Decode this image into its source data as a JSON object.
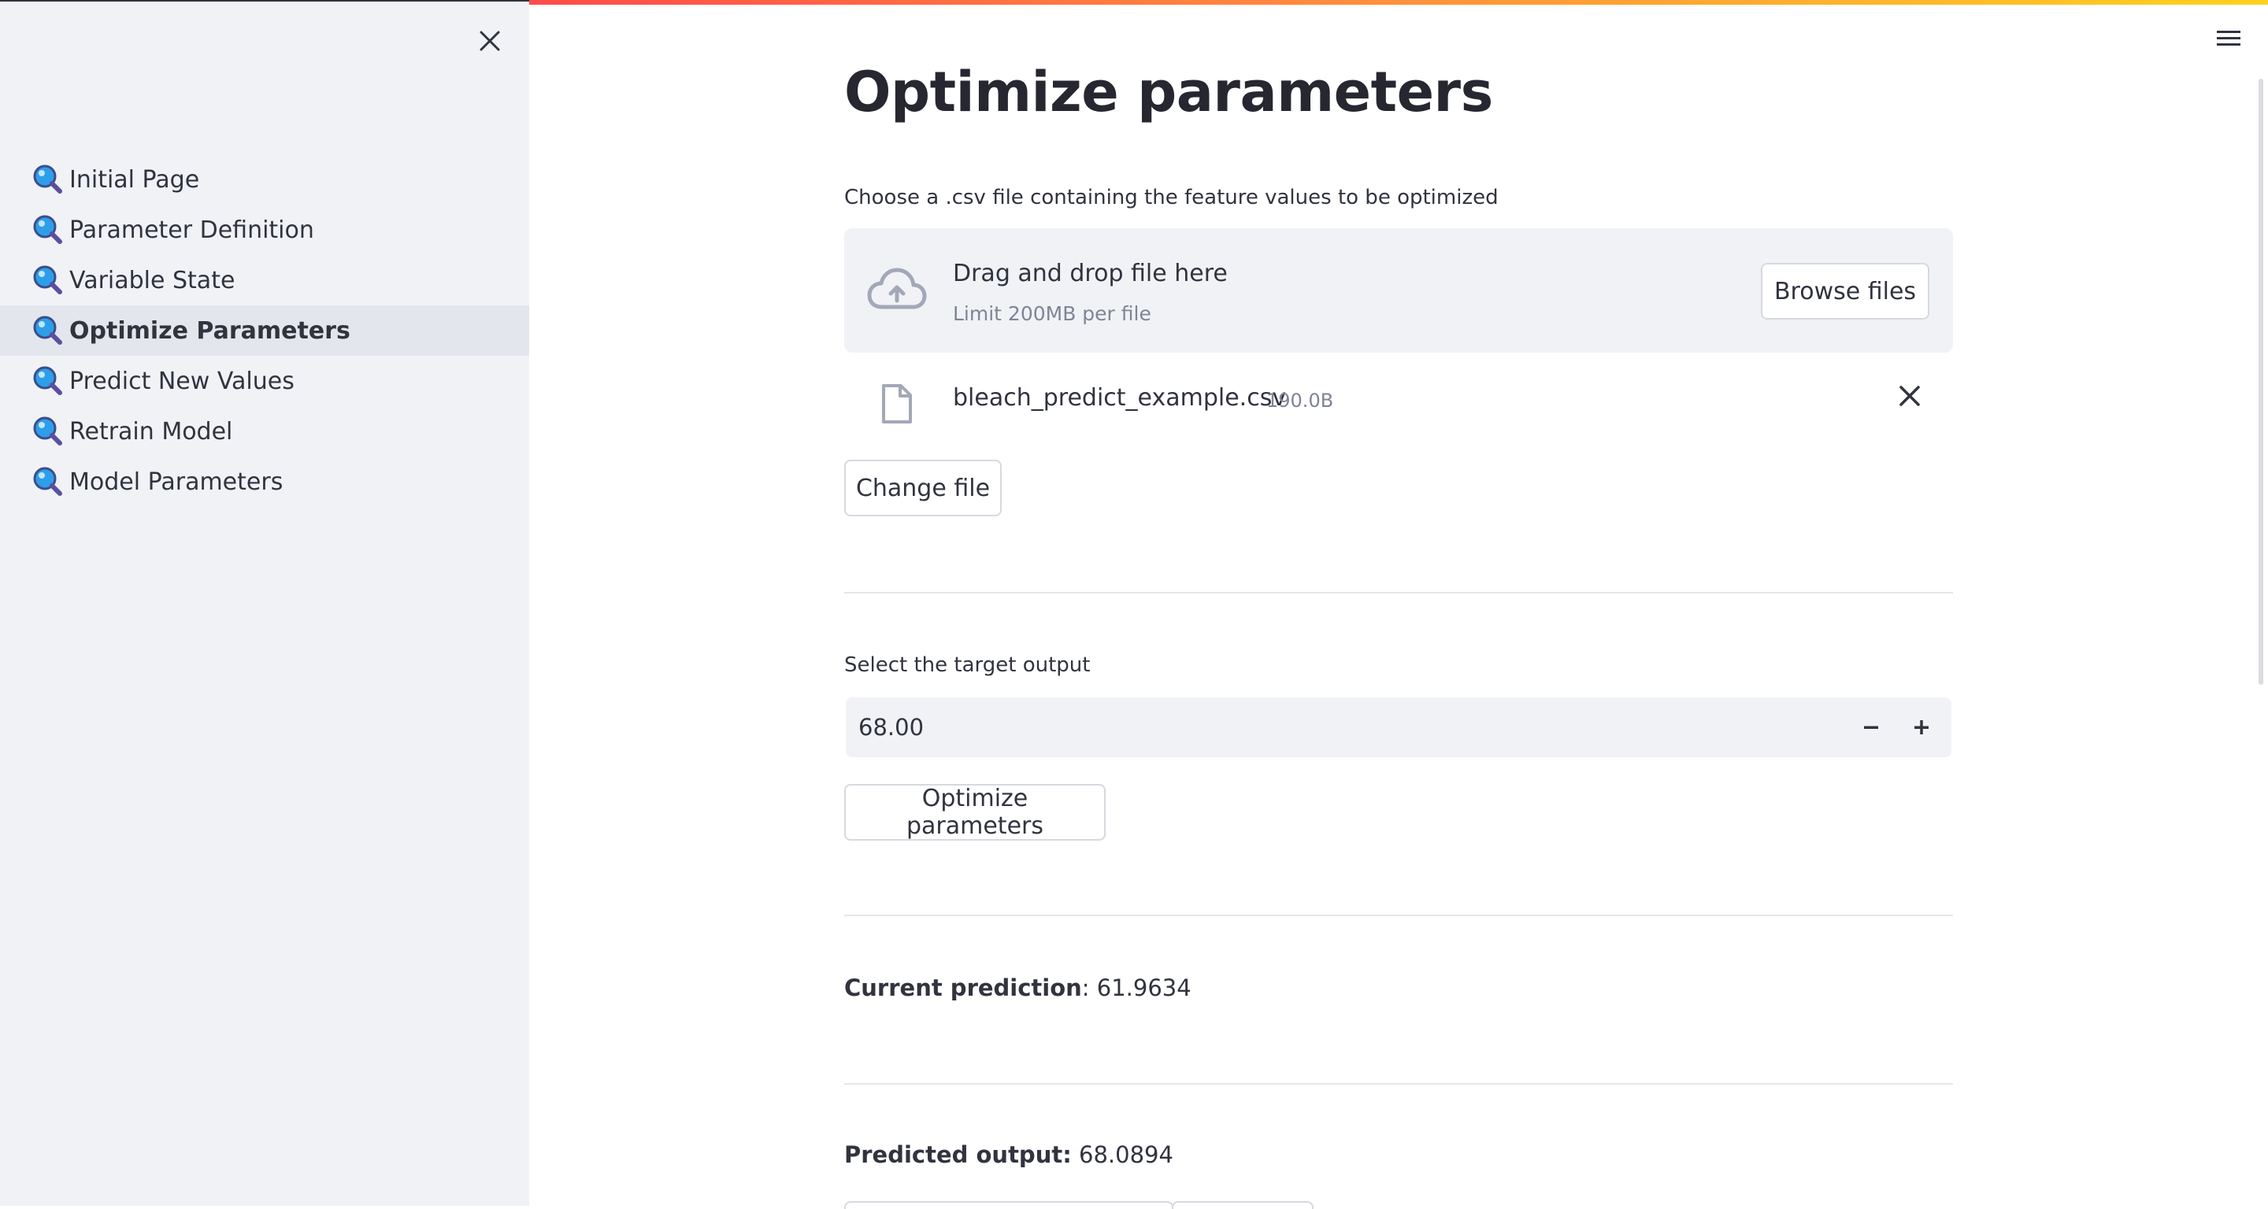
{
  "sidebar": {
    "items": [
      {
        "label": "Initial Page",
        "active": false
      },
      {
        "label": "Parameter Definition",
        "active": false
      },
      {
        "label": "Variable State",
        "active": false
      },
      {
        "label": "Optimize Parameters",
        "active": true
      },
      {
        "label": "Predict New Values",
        "active": false
      },
      {
        "label": "Retrain Model",
        "active": false
      },
      {
        "label": "Model Parameters",
        "active": false
      }
    ],
    "icon": "magnifier-icon"
  },
  "main": {
    "title": "Optimize parameters",
    "uploader": {
      "label": "Choose a .csv file containing the feature values to be optimized",
      "drop_title": "Drag and drop file here",
      "drop_limit": "Limit 200MB per file",
      "browse_label": "Browse files",
      "file_name": "bleach_predict_example.csv",
      "file_size": "190.0B",
      "change_label": "Change file"
    },
    "target": {
      "label": "Select the target output",
      "value": "68.00"
    },
    "optimize_label": "Optimize parameters",
    "current": {
      "label": "Current prediction",
      "value": ": 61.9634"
    },
    "predicted": {
      "label": "Predicted output:",
      "value": " 68.0894"
    }
  },
  "colors": {
    "sidebar_bg": "#f0f2f6",
    "accent_gradient": [
      "#ff4b4b",
      "#ffd21f"
    ],
    "text": "#31333f"
  }
}
